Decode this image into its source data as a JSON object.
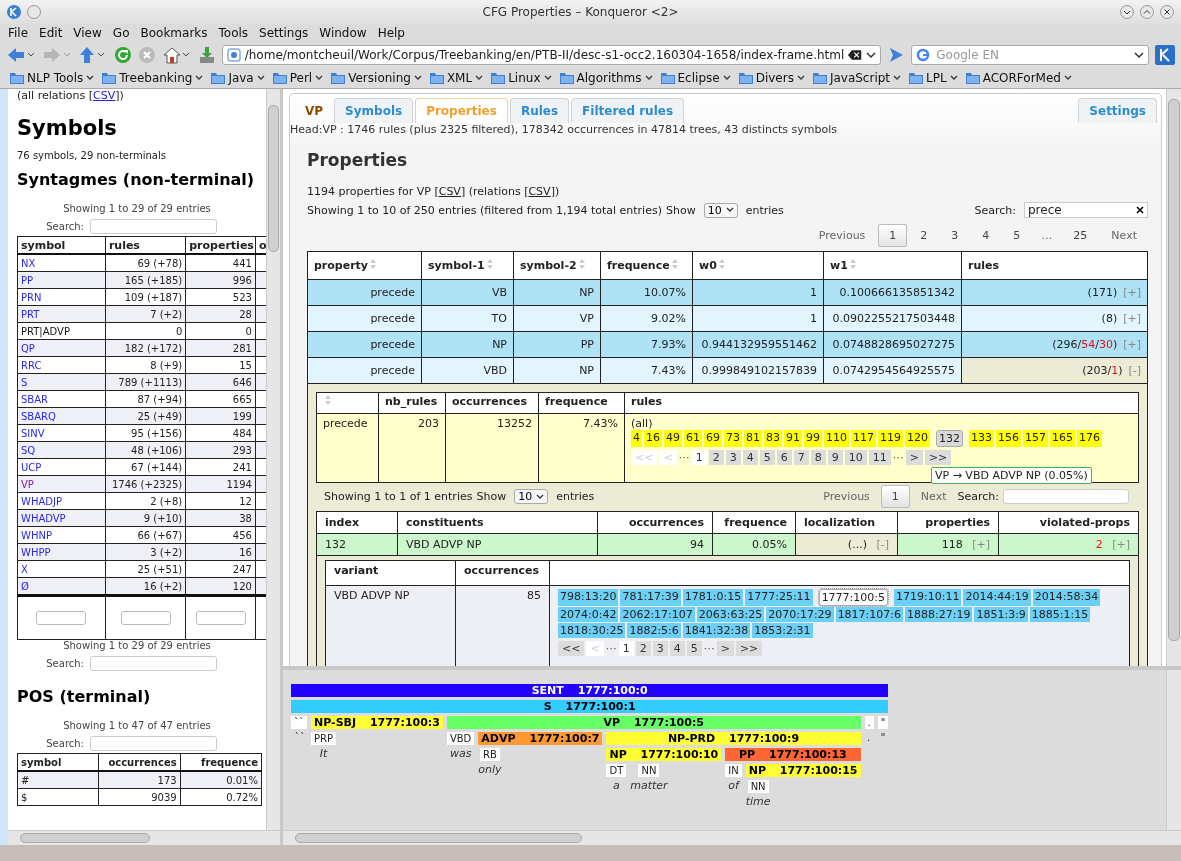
{
  "window": {
    "title": "CFG Properties – Konqueror <2>"
  },
  "menu": [
    "File",
    "Edit",
    "View",
    "Go",
    "Bookmarks",
    "Tools",
    "Settings",
    "Window",
    "Help"
  ],
  "address": {
    "value": "/home/montcheuil/Work/Corpus/Treebanking/en/PTB-II/desc-s1-occ2.160304-1658/index-frame.html"
  },
  "web_search": {
    "placeholder": "Google EN"
  },
  "bookmarks": [
    "NLP Tools",
    "Treebanking",
    "Java",
    "Perl",
    "Versioning",
    "XML",
    "Linux",
    "Algorithms",
    "Eclipse",
    "Divers",
    "JavaScript",
    "LPL",
    "ACORForMed"
  ],
  "sidebar": {
    "relations_note": [
      {
        "kind": "text",
        "text": "(all relations ["
      },
      {
        "kind": "link",
        "text": "CSV"
      },
      {
        "kind": "text",
        "text": "])"
      }
    ],
    "heading": "Symbols",
    "summary": "76 symbols, 29 non-terminals",
    "section": "Syntagmes (non-terminal)",
    "info": "Showing 1 to 29 of 29 entries",
    "search_label": "Search:",
    "columns": [
      "symbol",
      "rules",
      "properties",
      "o"
    ],
    "rows": [
      {
        "symbol": "NX",
        "rules": "69 (+78)",
        "properties": "441",
        "kind": "link"
      },
      {
        "symbol": "PP",
        "rules": "165 (+185)",
        "properties": "996",
        "kind": "link"
      },
      {
        "symbol": "PRN",
        "rules": "109 (+187)",
        "properties": "523",
        "kind": "link"
      },
      {
        "symbol": "PRT",
        "rules": "7 (+2)",
        "properties": "28",
        "kind": "link"
      },
      {
        "symbol": "PRT|ADVP",
        "rules": "0",
        "properties": "0",
        "kind": "plain"
      },
      {
        "symbol": "QP",
        "rules": "182 (+172)",
        "properties": "281",
        "kind": "link"
      },
      {
        "symbol": "RRC",
        "rules": "8 (+9)",
        "properties": "15",
        "kind": "link"
      },
      {
        "symbol": "S",
        "rules": "789 (+1113)",
        "properties": "646",
        "kind": "link"
      },
      {
        "symbol": "SBAR",
        "rules": "87 (+94)",
        "properties": "665",
        "kind": "link"
      },
      {
        "symbol": "SBARQ",
        "rules": "25 (+49)",
        "properties": "199",
        "kind": "link"
      },
      {
        "symbol": "SINV",
        "rules": "95 (+156)",
        "properties": "484",
        "kind": "link"
      },
      {
        "symbol": "SQ",
        "rules": "48 (+106)",
        "properties": "293",
        "kind": "link"
      },
      {
        "symbol": "UCP",
        "rules": "67 (+144)",
        "properties": "241",
        "kind": "link"
      },
      {
        "symbol": "VP",
        "rules": "1746 (+2325)",
        "properties": "1194",
        "kind": "visited"
      },
      {
        "symbol": "WHADJP",
        "rules": "2 (+8)",
        "properties": "12",
        "kind": "link"
      },
      {
        "symbol": "WHADVP",
        "rules": "9 (+10)",
        "properties": "38",
        "kind": "link"
      },
      {
        "symbol": "WHNP",
        "rules": "66 (+67)",
        "properties": "456",
        "kind": "link"
      },
      {
        "symbol": "WHPP",
        "rules": "3 (+2)",
        "properties": "16",
        "kind": "link"
      },
      {
        "symbol": "X",
        "rules": "25 (+51)",
        "properties": "247",
        "kind": "link"
      },
      {
        "symbol": "Ø",
        "rules": "16 (+2)",
        "properties": "120",
        "kind": "link"
      }
    ],
    "info_bottom": "Showing 1 to 29 of 29 entries",
    "search_label_bottom": "Search:",
    "pos_section": "POS (terminal)",
    "pos_info": "Showing 1 to 47 of 47 entries",
    "pos_search_label": "Search:",
    "pos_columns": [
      "symbol",
      "occurrences",
      "frequence"
    ],
    "pos_rows": [
      {
        "symbol": "#",
        "occurrences": "173",
        "frequence": "0.01%"
      },
      {
        "symbol": "$",
        "occurrences": "9039",
        "frequence": "0.72%"
      }
    ]
  },
  "tabs": [
    {
      "label": "VP",
      "kind": "head",
      "selected": false
    },
    {
      "label": "Symbols",
      "kind": "tab",
      "selected": false
    },
    {
      "label": "Properties",
      "kind": "tab",
      "selected": true
    },
    {
      "label": "Rules",
      "kind": "tab",
      "selected": false
    },
    {
      "label": "Filtered rules",
      "kind": "tab",
      "selected": false
    }
  ],
  "settings_tab": {
    "label": "Settings"
  },
  "head_summary": "Head:VP : 1746 rules (plus 2325 filtered), 178342 occurrences in 47814 trees, 43 distincts symbols",
  "properties": {
    "title": "Properties",
    "note": [
      {
        "kind": "text",
        "text": "1194 properties for VP ["
      },
      {
        "kind": "link",
        "text": "CSV"
      },
      {
        "kind": "text",
        "text": "] (relations ["
      },
      {
        "kind": "link",
        "text": "CSV"
      },
      {
        "kind": "text",
        "text": "])"
      }
    ],
    "info": "Showing 1 to 10 of 250 entries (filtered from 1,194 total entries)",
    "show_label": "Show",
    "show_value": "10",
    "entries_label": "entries",
    "search_label": "Search:",
    "search_value": "prece",
    "pagination": [
      {
        "label": "Previous",
        "kind": "nav"
      },
      {
        "label": "1",
        "kind": "current"
      },
      {
        "label": "2",
        "kind": "page"
      },
      {
        "label": "3",
        "kind": "page"
      },
      {
        "label": "4",
        "kind": "page"
      },
      {
        "label": "5",
        "kind": "page"
      },
      {
        "label": "…",
        "kind": "gap"
      },
      {
        "label": "25",
        "kind": "page"
      },
      {
        "label": "Next",
        "kind": "nav"
      }
    ],
    "columns": [
      "property",
      "symbol-1",
      "symbol-2",
      "frequence",
      "w0",
      "w1",
      "rules"
    ],
    "rows": [
      {
        "property": "precede",
        "symbol_1": "VB",
        "symbol_2": "NP",
        "frequence": "10.07%",
        "w0": "1",
        "w1": "0.100666135851342",
        "rules": [
          {
            "text": "(171)",
            "violation": false
          }
        ],
        "toggle": "[+]",
        "expanded": false
      },
      {
        "property": "precede",
        "symbol_1": "TO",
        "symbol_2": "VP",
        "frequence": "9.02%",
        "w0": "1",
        "w1": "0.0902255217503448",
        "rules": [
          {
            "text": "(8)",
            "violation": false
          }
        ],
        "toggle": "[+]",
        "expanded": false
      },
      {
        "property": "precede",
        "symbol_1": "NP",
        "symbol_2": "PP",
        "frequence": "7.93%",
        "w0": "0.944132959551462",
        "w1": "0.0748828695027275",
        "rules": [
          {
            "text": "(296/",
            "violation": false
          },
          {
            "text": "54",
            "violation": true
          },
          {
            "text": "/",
            "violation": false
          },
          {
            "text": "30",
            "violation": true
          },
          {
            "text": ")",
            "violation": false
          }
        ],
        "toggle": "[+]",
        "expanded": false
      },
      {
        "property": "precede",
        "symbol_1": "VBD",
        "symbol_2": "NP",
        "frequence": "7.43%",
        "w0": "0.999849102157839",
        "w1": "0.0742954564925575",
        "rules": [
          {
            "text": "(203/",
            "violation": false
          },
          {
            "text": "1",
            "violation": true
          },
          {
            "text": ")",
            "violation": false
          }
        ],
        "toggle": "[-]",
        "expanded": true
      }
    ]
  },
  "detail": {
    "columns": [
      "nb_rules",
      "occurrences",
      "frequence",
      "rules"
    ],
    "row": {
      "property": "precede",
      "nb_rules": "203",
      "occurrences": "13252",
      "frequence": "7.43%",
      "all_label": "(all)"
    },
    "rule_chips": [
      {
        "label": "4",
        "selected": false
      },
      {
        "label": "16",
        "selected": false
      },
      {
        "label": "49",
        "selected": false
      },
      {
        "label": "61",
        "selected": false
      },
      {
        "label": "69",
        "selected": false
      },
      {
        "label": "73",
        "selected": false
      },
      {
        "label": "81",
        "selected": false
      },
      {
        "label": "83",
        "selected": false
      },
      {
        "label": "91",
        "selected": false
      },
      {
        "label": "99",
        "selected": false
      },
      {
        "label": "110",
        "selected": false
      },
      {
        "label": "117",
        "selected": false
      },
      {
        "label": "119",
        "selected": false
      },
      {
        "label": "120",
        "selected": false
      },
      {
        "label": "132",
        "selected": true
      },
      {
        "label": "133",
        "selected": false
      },
      {
        "label": "156",
        "selected": false
      },
      {
        "label": "157",
        "selected": false
      },
      {
        "label": "165",
        "selected": false
      },
      {
        "label": "176",
        "selected": false
      }
    ],
    "rule_pager": [
      {
        "label": "<<",
        "kind": "disabled"
      },
      {
        "label": "<",
        "kind": "disabled"
      },
      {
        "label": "⋯",
        "kind": "gap"
      },
      {
        "label": "1",
        "kind": "current"
      },
      {
        "label": "2",
        "kind": "page"
      },
      {
        "label": "3",
        "kind": "page"
      },
      {
        "label": "4",
        "kind": "page"
      },
      {
        "label": "5",
        "kind": "page"
      },
      {
        "label": "6",
        "kind": "page"
      },
      {
        "label": "7",
        "kind": "page"
      },
      {
        "label": "8",
        "kind": "page"
      },
      {
        "label": "9",
        "kind": "page"
      },
      {
        "label": "10",
        "kind": "page"
      },
      {
        "label": "11",
        "kind": "page"
      },
      {
        "label": "⋯",
        "kind": "gap"
      },
      {
        "label": ">",
        "kind": "page"
      },
      {
        "label": ">>",
        "kind": "page"
      }
    ],
    "tooltip": "VP → VBD ADVP NP (0.05%)",
    "info": "Showing 1 to 1 of 1 entries",
    "show_label": "Show",
    "show_value": "10",
    "entries_label": "entries",
    "pagination": [
      {
        "label": "Previous",
        "kind": "nav"
      },
      {
        "label": "1",
        "kind": "current"
      },
      {
        "label": "Next",
        "kind": "nav"
      }
    ],
    "search_label": "Search:",
    "sub_columns": [
      "index",
      "constituents",
      "occurrences",
      "frequence",
      "localization",
      "properties",
      "violated-props"
    ],
    "sub_row": {
      "index": "132",
      "constituents": "VBD ADVP NP",
      "occurrences": "94",
      "frequence": "0.05%",
      "localization": "(...)",
      "localization_toggle": "[-]",
      "properties": "118",
      "properties_toggle": "[+]",
      "violated": "2",
      "violated_toggle": "[+]"
    },
    "variant_columns": [
      "variant",
      "occurrences"
    ],
    "variant_row": {
      "variant": "VBD ADVP NP",
      "occurrences": "85"
    },
    "locations": [
      {
        "label": "798:13:20",
        "selected": false
      },
      {
        "label": "781:17:39",
        "selected": false
      },
      {
        "label": "1781:0:15",
        "selected": false
      },
      {
        "label": "1777:25:11",
        "selected": false
      },
      {
        "label": "1777:100:5",
        "selected": true
      },
      {
        "label": "1719:10:11",
        "selected": false
      },
      {
        "label": "2014:44:19",
        "selected": false
      },
      {
        "label": "2014:58:34",
        "selected": false
      },
      {
        "label": "2074:0:42",
        "selected": false
      },
      {
        "label": "2062:17:107",
        "selected": false
      },
      {
        "label": "2063:63:25",
        "selected": false
      },
      {
        "label": "2070:17:29",
        "selected": false
      },
      {
        "label": "1817:107:6",
        "selected": false
      },
      {
        "label": "1888:27:19",
        "selected": false
      },
      {
        "label": "1851:3:9",
        "selected": false
      },
      {
        "label": "1885:1:15",
        "selected": false
      },
      {
        "label": "1818:30:25",
        "selected": false
      },
      {
        "label": "1882:5:6",
        "selected": false
      },
      {
        "label": "1841:32:38",
        "selected": false
      },
      {
        "label": "1853:2:31",
        "selected": false
      }
    ],
    "location_pager": [
      {
        "label": "<<",
        "kind": "page"
      },
      {
        "label": "<",
        "kind": "disabled"
      },
      {
        "label": "⋯",
        "kind": "gap"
      },
      {
        "label": "1",
        "kind": "current"
      },
      {
        "label": "2",
        "kind": "page"
      },
      {
        "label": "3",
        "kind": "page"
      },
      {
        "label": "4",
        "kind": "page"
      },
      {
        "label": "5",
        "kind": "page"
      },
      {
        "label": "⋯",
        "kind": "gap"
      },
      {
        "label": ">",
        "kind": "page"
      },
      {
        "label": ">>",
        "kind": "page"
      }
    ]
  },
  "tree": {
    "kind": "phrase",
    "label": "SENT",
    "id": "1777:100:0",
    "color": "#2200ff",
    "children": [
      {
        "kind": "phrase",
        "label": "S",
        "id": "1777:100:1",
        "color": "#33ccff",
        "children": [
          {
            "kind": "leaf",
            "tag": "``",
            "word": "``"
          },
          {
            "kind": "phrase",
            "label": "NP-SBJ",
            "id": "1777:100:3",
            "color": "#ffff33",
            "children": [
              {
                "kind": "leaf",
                "tag": "PRP",
                "word": "It"
              }
            ]
          },
          {
            "kind": "phrase",
            "label": "VP",
            "id": "1777:100:5",
            "color": "#66ff66",
            "children": [
              {
                "kind": "leaf",
                "tag": "VBD",
                "word": "was"
              },
              {
                "kind": "phrase",
                "label": "ADVP",
                "id": "1777:100:7",
                "color": "#ff9933",
                "children": [
                  {
                    "kind": "leaf",
                    "tag": "RB",
                    "word": "only"
                  }
                ]
              },
              {
                "kind": "phrase",
                "label": "NP-PRD",
                "id": "1777:100:9",
                "color": "#ffff33",
                "children": [
                  {
                    "kind": "phrase",
                    "label": "NP",
                    "id": "1777:100:10",
                    "color": "#ffff33",
                    "children": [
                      {
                        "kind": "leaf",
                        "tag": "DT",
                        "word": "a"
                      },
                      {
                        "kind": "leaf",
                        "tag": "NN",
                        "word": "matter"
                      }
                    ]
                  },
                  {
                    "kind": "phrase",
                    "label": "PP",
                    "id": "1777:100:13",
                    "color": "#ff6633",
                    "children": [
                      {
                        "kind": "leaf",
                        "tag": "IN",
                        "word": "of"
                      },
                      {
                        "kind": "phrase",
                        "label": "NP",
                        "id": "1777:100:15",
                        "color": "#ffff33",
                        "children": [
                          {
                            "kind": "leaf",
                            "tag": "NN",
                            "word": "time"
                          }
                        ]
                      }
                    ]
                  }
                ]
              }
            ]
          },
          {
            "kind": "leaf",
            "tag": ".",
            "word": "."
          },
          {
            "kind": "leaf",
            "tag": "\"",
            "word": "\""
          }
        ]
      }
    ]
  }
}
